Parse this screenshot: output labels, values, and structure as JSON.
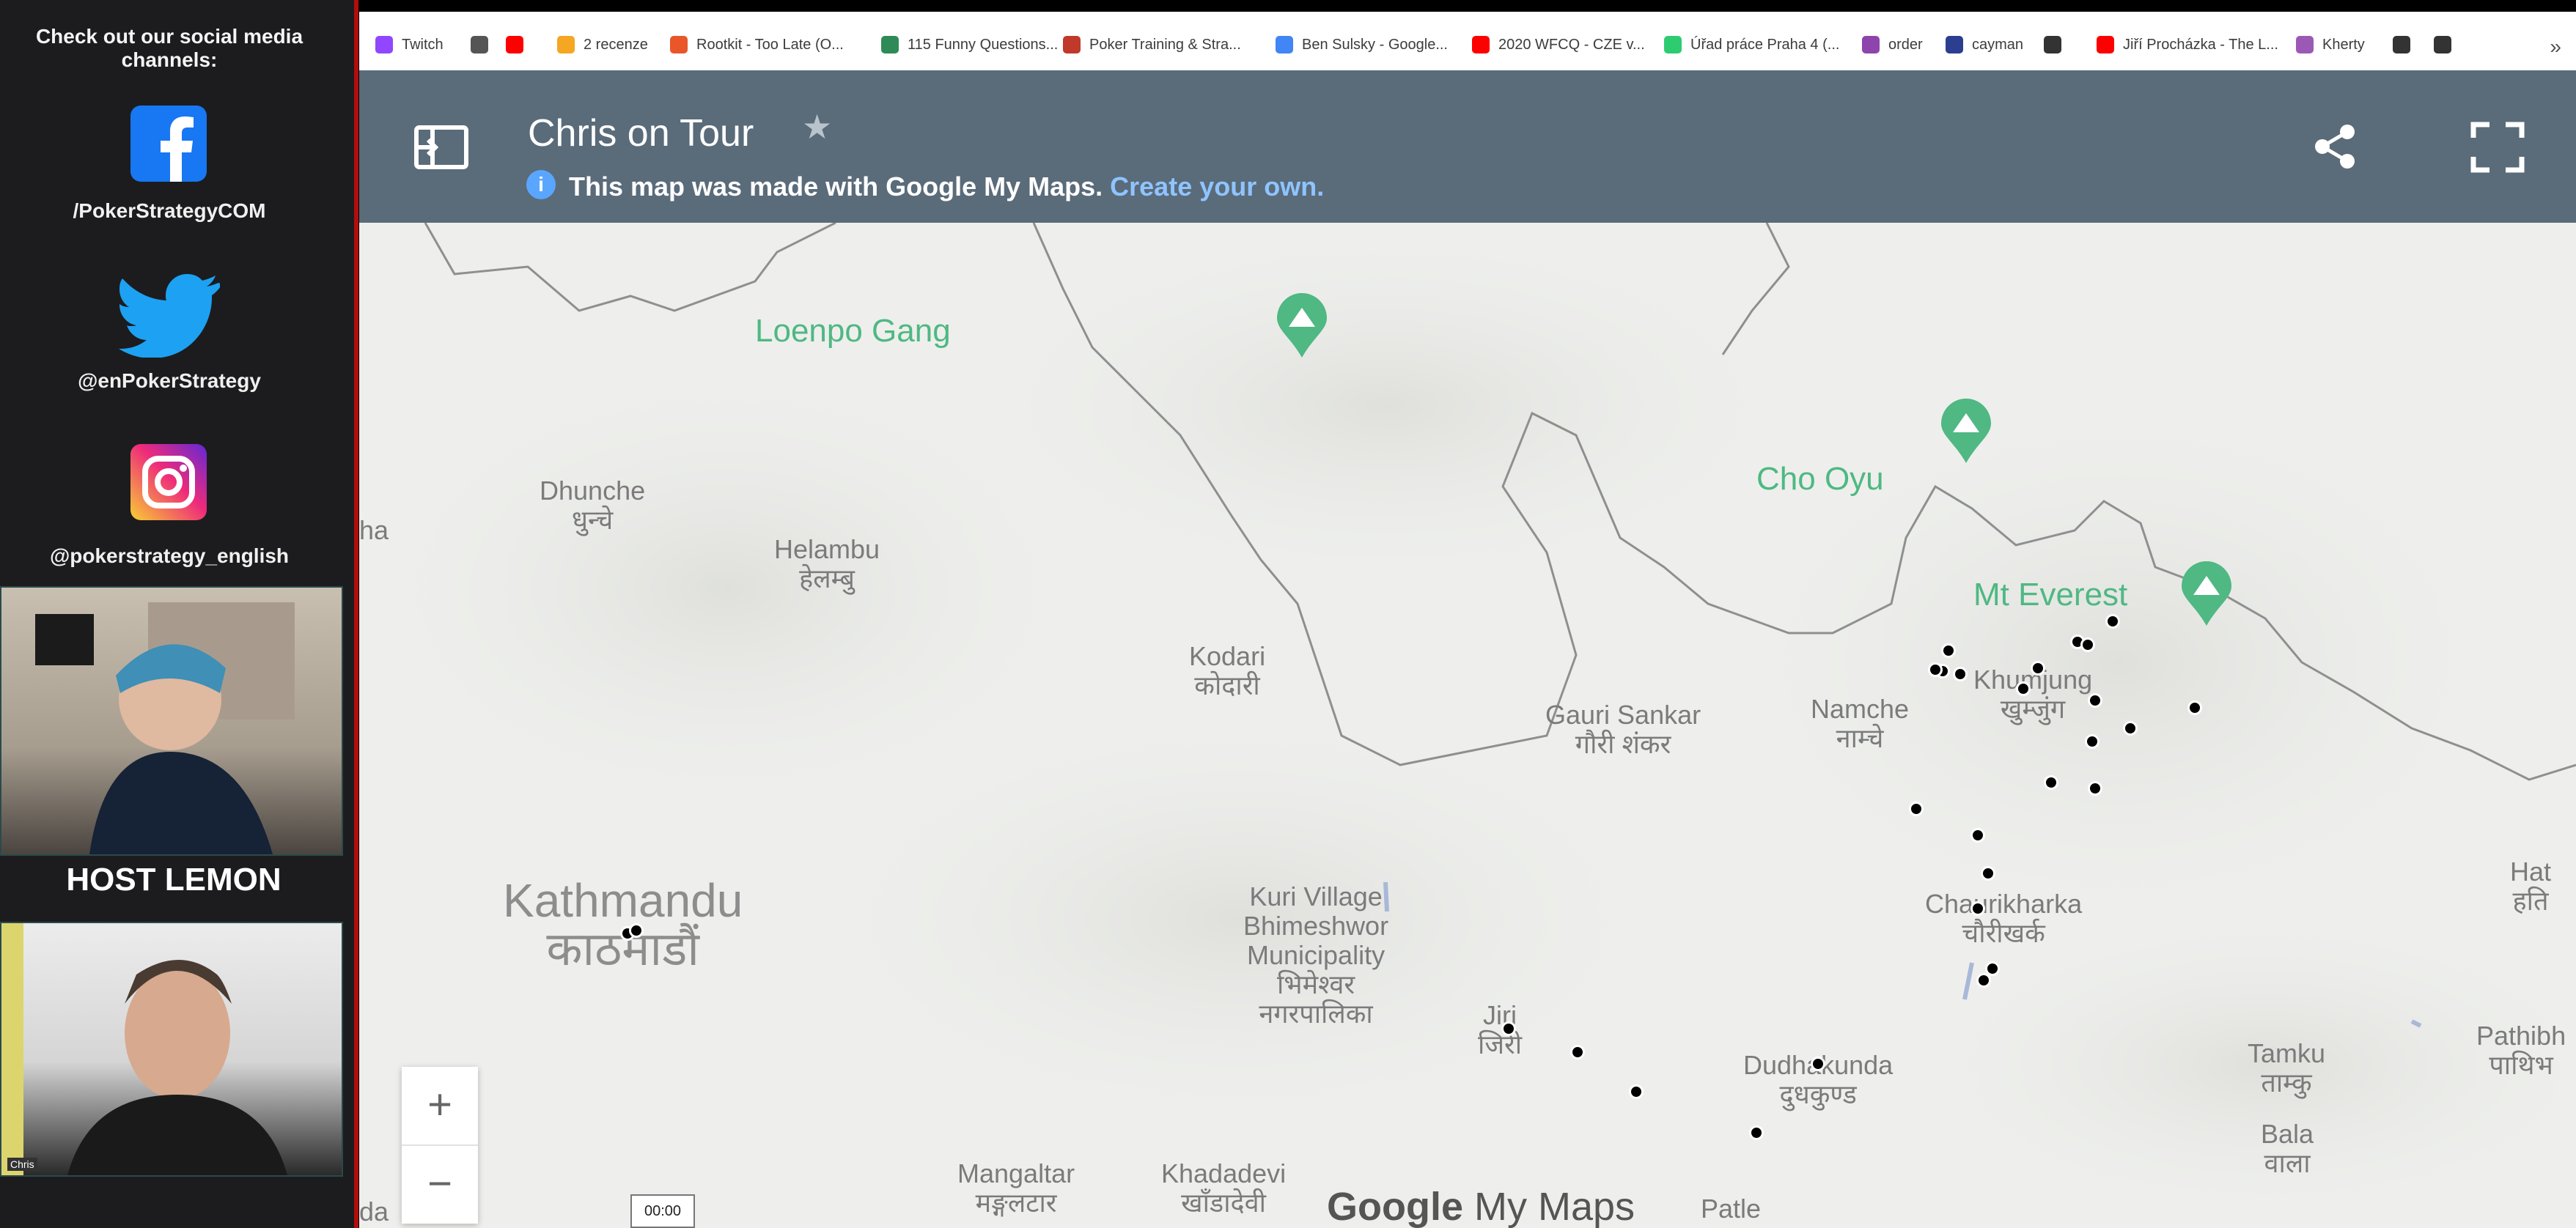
{
  "sidebar": {
    "cta": "Check out our social media channels:",
    "facebook_handle": "/PokerStrategyCOM",
    "twitter_handle": "@enPokerStrategy",
    "instagram_handle": "@pokerstrategy_english",
    "host_label": "HOST LEMON",
    "guest_tag": "Chris",
    "icons": [
      "facebook-icon",
      "twitter-icon",
      "instagram-icon"
    ]
  },
  "browser": {
    "bookmarks": [
      {
        "label": "Twitch",
        "color": "#9146ff"
      },
      {
        "label": "",
        "color": "#555555"
      },
      {
        "label": "",
        "color": "#ff0000"
      },
      {
        "label": "2 recenze",
        "color": "#f5a623"
      },
      {
        "label": "Rootkit - Too Late (O...",
        "color": "#e8562a"
      },
      {
        "label": "115 Funny Questions...",
        "color": "#2e8b57"
      },
      {
        "label": "Poker Training & Stra...",
        "color": "#c0392b"
      },
      {
        "label": "Ben Sulsky - Google...",
        "color": "#4285f4"
      },
      {
        "label": "2020 WFCQ - CZE v...",
        "color": "#ff0000"
      },
      {
        "label": "Úřad práce Praha 4 (...",
        "color": "#2ecc71"
      },
      {
        "label": "order",
        "color": "#8e44ad"
      },
      {
        "label": "cayman",
        "color": "#2c3e8f"
      },
      {
        "label": "",
        "color": "#333333"
      },
      {
        "label": "Jiří Procházka - The L...",
        "color": "#ff0000"
      },
      {
        "label": "Kherty",
        "color": "#9b59b6"
      },
      {
        "label": "",
        "color": "#333333"
      },
      {
        "label": "",
        "color": "#333333"
      }
    ],
    "overflow": "»"
  },
  "map_header": {
    "title": "Chris on Tour",
    "star": "★",
    "info": "i",
    "made_with": "This map was made with Google My Maps.",
    "create_link": "Create your own.",
    "accent": "#5a6b7a"
  },
  "map": {
    "places": [
      "Loenpo Gang",
      "Cho Oyu",
      "Mt Everest",
      "Dhunche",
      "धुन्चे",
      "Helambu",
      "हेलम्बु",
      "Kodari",
      "कोदारी",
      "Gauri Sankar",
      "गौरी शंकर",
      "Namche",
      "नाम्चे",
      "Khumjung",
      "खुम्जुंग",
      "Kathmandu",
      "काठमाडौं",
      "Kuri Village",
      "Bhimeshwor",
      "Municipality",
      "भिमेश्वर",
      "नगरपालिका",
      "Jiri",
      "जिरी",
      "Chaurikharka",
      "चौरीखर्क",
      "Dudhakunda",
      "दुधकुण्ड",
      "Tamku",
      "ताम्कु",
      "Bala",
      "वाला",
      "Mangaltar",
      "मङ्गलटार",
      "Khadadevi",
      "खाँडादेवी",
      "Patle",
      "Hat",
      "हति",
      "Pathibh",
      "पाथिभ",
      "ha",
      "da"
    ],
    "zoom_in": "+",
    "zoom_out": "−",
    "watermark_brand": "Google",
    "watermark_product": " My Maps",
    "pin_color": "#000000",
    "peak_color": "#4fb883"
  },
  "video": {
    "timecode": "00:00"
  }
}
